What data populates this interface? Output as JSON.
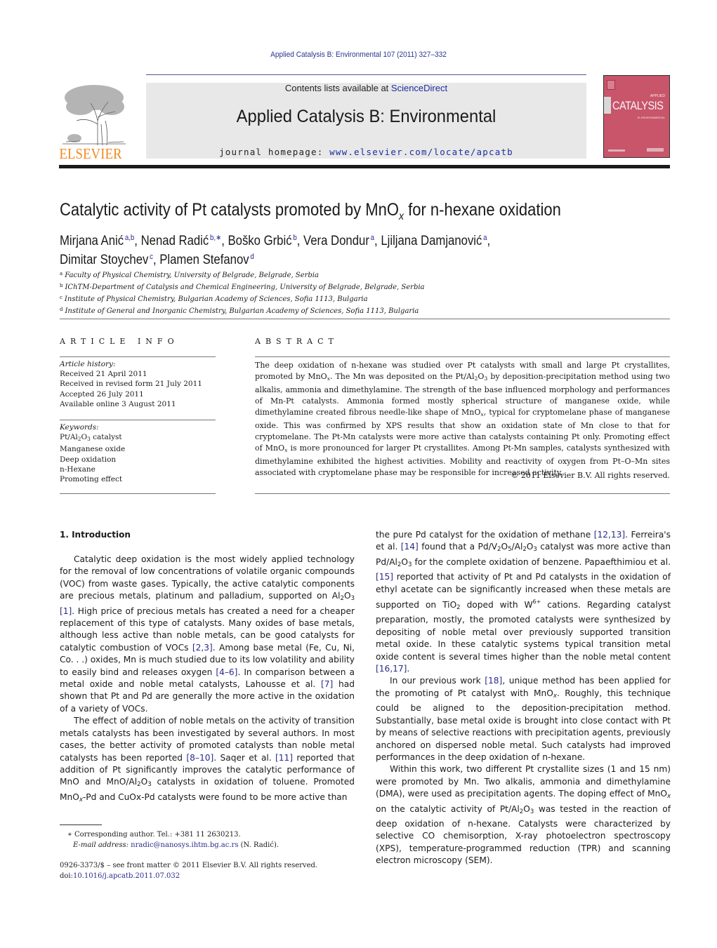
{
  "header": {
    "citation": "Applied Catalysis B: Environmental 107 (2011) 327–332",
    "contents_prefix": "Contents lists available at ",
    "contents_link": "ScienceDirect",
    "journal_title": "Applied Catalysis B: Environmental",
    "homepage_prefix": "journal homepage: ",
    "homepage_url": "www.elsevier.com/locate/apcatb",
    "publisher_logo_text": "ELSEVIER",
    "cover": {
      "applied": "APPLIED",
      "catalysis": "CATALYSIS",
      "subtitle": "B: ENVIRONMENTAL",
      "color": "#c9556a"
    }
  },
  "article": {
    "title_prefix": "Catalytic activity of Pt catalysts promoted by MnO",
    "title_sub": "x",
    "title_suffix": " for n-hexane oxidation",
    "authors": [
      {
        "name": "Mirjana Anić",
        "aff": "a,b",
        "sep": ", "
      },
      {
        "name": "Nenad Radić",
        "aff": "b,∗",
        "sep": ", "
      },
      {
        "name": "Boško Grbić",
        "aff": "b",
        "sep": ", "
      },
      {
        "name": "Vera Dondur",
        "aff": "a",
        "sep": ", "
      },
      {
        "name": "Ljiljana Damjanović",
        "aff": "a",
        "sep": ","
      },
      {
        "name": "Dimitar Stoychev",
        "aff": "c",
        "sep": ", "
      },
      {
        "name": "Plamen Stefanov",
        "aff": "d",
        "sep": ""
      }
    ],
    "affiliations": [
      {
        "mark": "a",
        "text": "Faculty of Physical Chemistry, University of Belgrade, Belgrade, Serbia"
      },
      {
        "mark": "b",
        "text": "IChTM-Department of Catalysis and Chemical Engineering, University of Belgrade, Belgrade, Serbia"
      },
      {
        "mark": "c",
        "text": "Institute of Physical Chemistry, Bulgarian Academy of Sciences, Sofia 1113, Bulgaria"
      },
      {
        "mark": "d",
        "text": "Institute of General and Inorganic Chemistry, Bulgarian Academy of Sciences, Sofia 1113, Bulgaria"
      }
    ]
  },
  "article_info": {
    "heading": "ARTICLE INFO",
    "history_label": "Article history:",
    "history": [
      "Received 21 April 2011",
      "Received in revised form 21 July 2011",
      "Accepted 26 July 2011",
      "Available online 3 August 2011"
    ],
    "keywords_label": "Keywords:",
    "keywords": [
      "Pt/Al2O3 catalyst",
      "Manganese oxide",
      "Deep oxidation",
      "n-Hexane",
      "Promoting effect"
    ]
  },
  "abstract": {
    "heading": "ABSTRACT",
    "text": "The deep oxidation of n-hexane was studied over Pt catalysts with small and large Pt crystallites, promoted by MnOx. The Mn was deposited on the Pt/Al2O3 by deposition-precipitation method using two alkalis, ammonia and dimethylamine. The strength of the base influenced morphology and performances of Mn-Pt catalysts. Ammonia formed mostly spherical structure of manganese oxide, while dimethylamine created fibrous needle-like shape of MnOx, typical for cryptomelane phase of manganese oxide. This was confirmed by XPS results that show an oxidation state of Mn close to that for cryptomelane. The Pt-Mn catalysts were more active than catalysts containing Pt only. Promoting effect of MnOx is more pronounced for larger Pt crystallites. Among Pt-Mn samples, catalysts synthesized with dimethylamine exhibited the highest activities. Mobility and reactivity of oxygen from Pt–O–Mn sites associated with cryptomelane phase may be responsible for increased activity.",
    "copyright": "© 2011 Elsevier B.V. All rights reserved."
  },
  "introduction": {
    "heading": "1.  Introduction",
    "paragraphs_left": [
      "Catalytic deep oxidation is the most widely applied technology for the removal of low concentrations of volatile organic compounds (VOC) from waste gases. Typically, the active catalytic components are precious metals, platinum and palladium, supported on Al2O3 [1]. High price of precious metals has created a need for a cheaper replacement of this type of catalysts. Many oxides of base metals, although less active than noble metals, can be good catalysts for catalytic combustion of VOCs [2,3]. Among base metal (Fe, Cu, Ni, Co. . .) oxides, Mn is much studied due to its low volatility and ability to easily bind and releases oxygen [4–6]. In comparison between a metal oxide and noble metal catalysts, Lahousse et al. [7] had shown that Pt and Pd are generally the more active in the oxidation of a variety of VOCs.",
      "The effect of addition of noble metals on the activity of transition metals catalysts has been investigated by several authors. In most cases, the better activity of promoted catalysts than noble metal catalysts has been reported [8–10]. Saqer et al. [11] reported that addition of Pt significantly improves the catalytic performance of MnO and MnO/Al2O3 catalysts in oxidation of toluene. Promoted MnOx-Pd and CuOx-Pd catalysts were found to be more active than"
    ],
    "paragraphs_right": [
      "the pure Pd catalyst for the oxidation of methane [12,13]. Ferreira's et al. [14] found that a Pd/V2O5/Al2O3 catalyst was more active than Pd/Al2O3 for the complete oxidation of benzene. Papaefthimiou et al. [15] reported that activity of Pt and Pd catalysts in the oxidation of ethyl acetate can be significantly increased when these metals are supported on TiO2 doped with W6+ cations. Regarding catalyst preparation, mostly, the promoted catalysts were synthesized by depositing of noble metal over previously supported transition metal oxide. In these catalytic systems typical transition metal oxide content is several times higher than the noble metal content [16,17].",
      "In our previous work [18], unique method has been applied for the promoting of Pt catalyst with MnOx. Roughly, this technique could be aligned to the deposition-precipitation method. Substantially, base metal oxide is brought into close contact with Pt by means of selective reactions with precipitation agents, previously anchored on dispersed noble metal. Such catalysts had improved performances in the deep oxidation of n-hexane.",
      "Within this work, two different Pt crystallite sizes (1 and 15 nm) were promoted by Mn. Two alkalis, ammonia and dimethylamine (DMA), were used as precipitation agents. The doping effect of MnOx on the catalytic activity of Pt/Al2O3 was tested in the reaction of deep oxidation of n-hexane. Catalysts were characterized by selective CO chemisorption, X-ray photoelectron spectroscopy (XPS), temperature-programmed reduction (TPR) and scanning electron microscopy (SEM)."
    ]
  },
  "footnote": {
    "star": "∗",
    "corresponding": "Corresponding author. Tel.: +381 11 2630213.",
    "email_label": "E-mail address:",
    "email": "nradic@nanosys.ihtm.bg.ac.rs",
    "email_suffix": " (N. Radić)."
  },
  "frontmatter": {
    "issn_line": "0926-3373/$ – see front matter © 2011 Elsevier B.V. All rights reserved.",
    "doi_prefix": "doi:",
    "doi": "10.1016/j.apcatb.2011.07.032"
  },
  "colors": {
    "link": "#2a2a8c",
    "elsevier_orange": "#f08a22",
    "header_box": "#e8e8e8"
  }
}
